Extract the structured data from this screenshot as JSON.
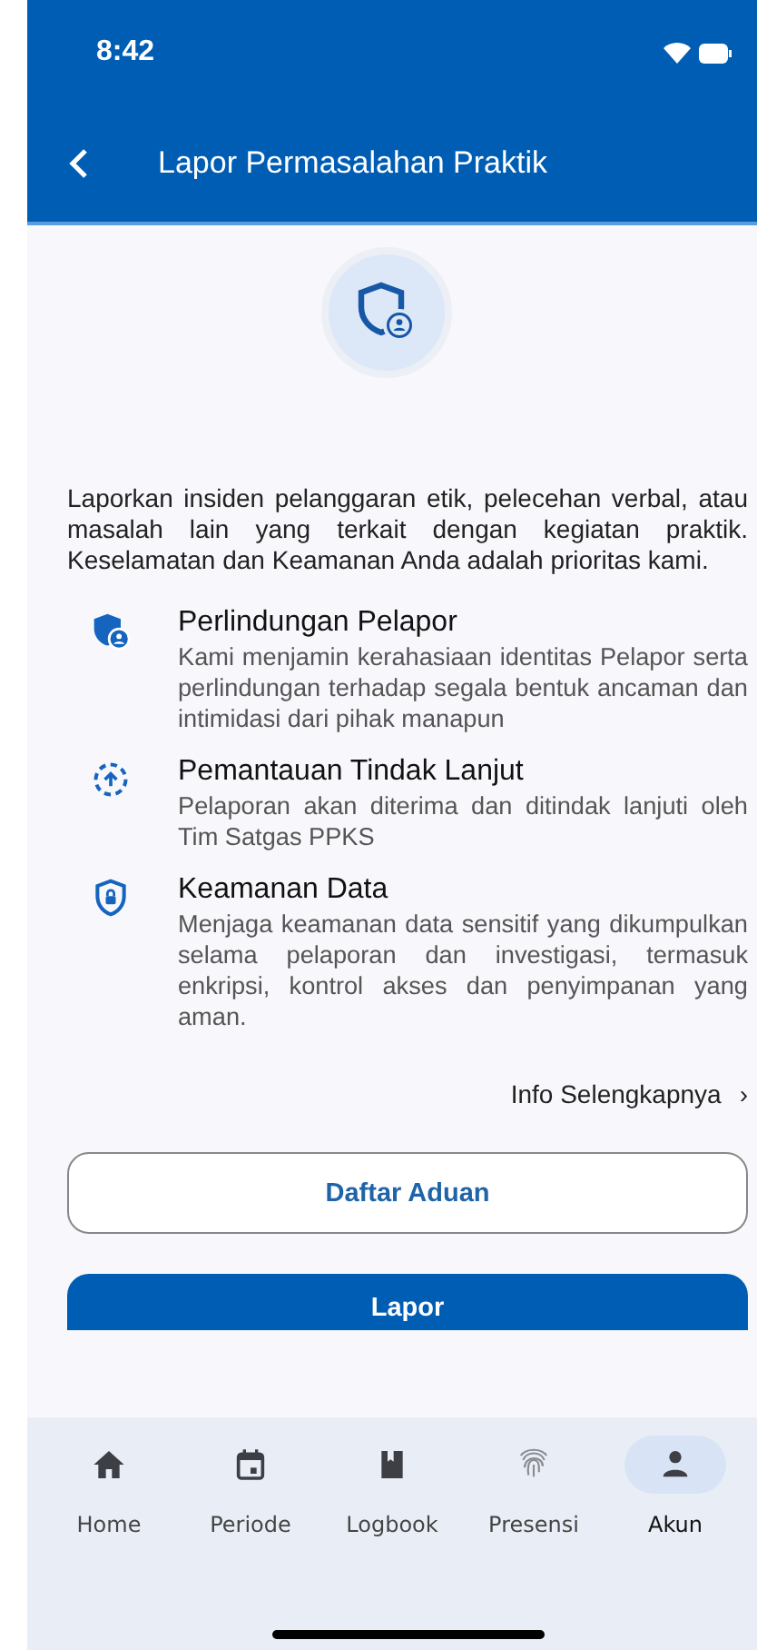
{
  "status_bar": {
    "time": "8:42"
  },
  "header": {
    "title": "Lapor Permasalahan Praktik"
  },
  "intro": "Laporkan insiden pelanggaran etik, pelecehan verbal, atau masalah lain yang terkait dengan kegiatan praktik. Keselamatan dan Keamanan Anda adalah prioritas kami.",
  "features": [
    {
      "kind": "shield-person",
      "title": "Perlindungan Pelapor",
      "description": "Kami menjamin kerahasiaan identitas Pelapor serta perlindungan terhadap segala bentuk ancaman dan intimidasi dari pihak manapun"
    },
    {
      "kind": "upload",
      "title": "Pemantauan Tindak Lanjut",
      "description": "Pelaporan akan diterima dan ditindak lanjuti oleh Tim Satgas PPKS"
    },
    {
      "kind": "lock",
      "title": "Keamanan Data",
      "description": "Menjaga keamanan data sensitif yang dikumpulkan selama pelaporan dan investigasi, termasuk enkripsi, kontrol akses dan penyimpanan yang aman."
    }
  ],
  "more_link": "Info Selengkapnya",
  "more_link_icon": "›",
  "buttons": [
    {
      "kind": "outline",
      "label": "Daftar Aduan"
    },
    {
      "kind": "filled",
      "label": "Lapor"
    }
  ],
  "nav": [
    {
      "kind": "home",
      "label": "Home",
      "selected": false
    },
    {
      "kind": "calendar",
      "label": "Periode",
      "selected": false
    },
    {
      "kind": "book",
      "label": "Logbook",
      "selected": false
    },
    {
      "kind": "fingerprint",
      "label": "Presensi",
      "selected": false
    },
    {
      "kind": "person",
      "label": "Akun",
      "selected": true
    }
  ]
}
